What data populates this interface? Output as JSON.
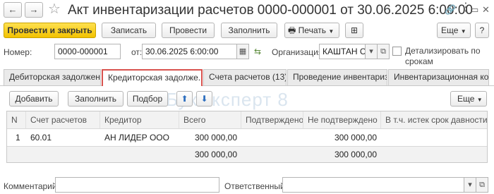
{
  "titlebar": {
    "back_icon": "←",
    "forward_icon": "→",
    "title": "Акт инвентаризации расчетов 0000-000001 от 30.06.2025 6:00:00"
  },
  "commandbar": {
    "post_and_close": "Провести и закрыть",
    "save": "Записать",
    "post": "Провести",
    "fill": "Заполнить",
    "print": "Печать",
    "more": "Еще"
  },
  "header": {
    "number_label": "Номер:",
    "number_value": "0000-000001",
    "date_label": "от:",
    "date_value": "30.06.2025  6:00:00",
    "org_label": "Организация:",
    "org_value": "КАШТАН С",
    "detail_label_1": "Детализировать по",
    "detail_label_2": "срокам"
  },
  "tabs": [
    {
      "label": "Дебиторская задолжен..."
    },
    {
      "label": "Кредиторская задолже..."
    },
    {
      "label": "Счета расчетов (13)"
    },
    {
      "label": "Проведение инвентариз..."
    },
    {
      "label": "Инвентаризационная ко..."
    }
  ],
  "tabbar": {
    "add": "Добавить",
    "fill": "Заполнить",
    "select": "Подбор",
    "more": "Еще"
  },
  "watermark": "БухЭксперт 8",
  "table": {
    "columns": [
      "N",
      "Счет расчетов",
      "Кредитор",
      "Всего",
      "Подтверждено",
      "Не подтверждено",
      "В т.ч. истек срок давности"
    ],
    "rows": [
      {
        "n": "1",
        "account": "60.01",
        "creditor": "АН ЛИДЕР ООО",
        "total": "300 000,00",
        "confirmed": "",
        "unconfirmed": "300 000,00",
        "expired": ""
      }
    ],
    "footer": {
      "total": "300 000,00",
      "unconfirmed": "300 000,00"
    }
  },
  "bottom": {
    "comment_label": "Комментарий:",
    "responsible_label": "Ответственный:"
  },
  "colors": {
    "primary_button": "#f2c200",
    "active_tab_border": "#d9534f"
  }
}
